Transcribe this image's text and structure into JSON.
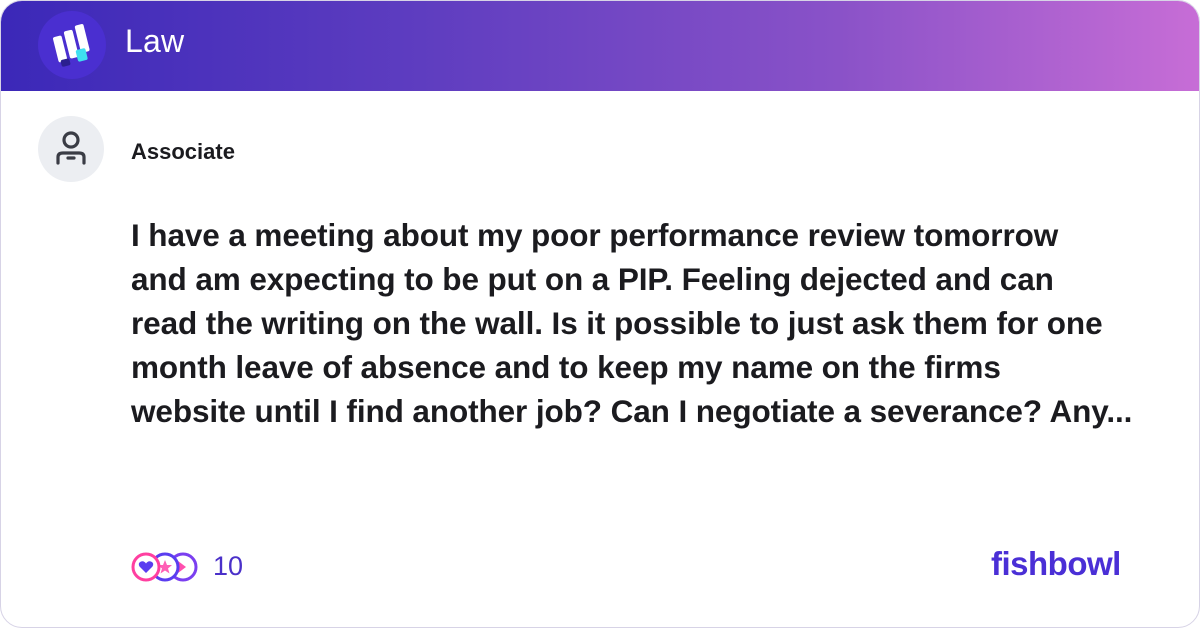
{
  "header": {
    "bowl_title": "Law",
    "logo_icon": "bowl-logo-icon",
    "gradient": [
      "#3b28b8",
      "#c76dd6"
    ]
  },
  "post": {
    "author": "Associate",
    "avatar_icon": "user-icon",
    "body_lines": [
      "I have a meeting about my poor performance review tomorrow",
      "and am expecting to be put on a PIP. Feeling dejected and can",
      "read the writing on the wall. Is it possible to just ask them for one",
      "month leave of absence and to keep my name on the firms",
      "website until I find another job? Can I negotiate a severance? Any..."
    ]
  },
  "footer": {
    "reaction_icons": [
      "heart-reaction-icon",
      "star-reaction-icon",
      "clap-reaction-icon"
    ],
    "reaction_count": "10",
    "brand": "fishbowl",
    "brand_color": "#4a2fd6"
  }
}
